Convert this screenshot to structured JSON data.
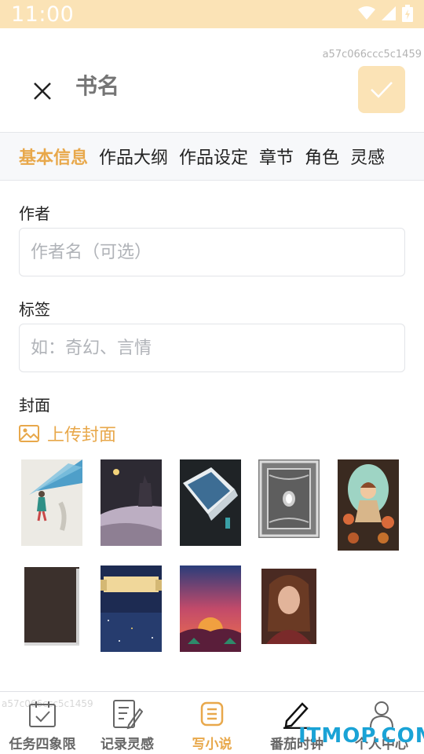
{
  "status_bar": {
    "time": "11:00",
    "icons": [
      "wifi-icon",
      "signal-icon",
      "battery-icon"
    ]
  },
  "watermark_id": "a57c066ccc5c1459",
  "header": {
    "title_placeholder": "书名",
    "close_icon": "close-icon",
    "confirm_icon": "check-icon"
  },
  "tabs": [
    {
      "label": "基本信息",
      "active": true
    },
    {
      "label": "作品大纲",
      "active": false
    },
    {
      "label": "作品设定",
      "active": false
    },
    {
      "label": "章节",
      "active": false
    },
    {
      "label": "角色",
      "active": false
    },
    {
      "label": "灵感",
      "active": false
    }
  ],
  "form": {
    "author": {
      "label": "作者",
      "placeholder": "作者名（可选）",
      "value": ""
    },
    "tags": {
      "label": "标签",
      "placeholder": "如：奇幻、言情",
      "value": ""
    },
    "cover": {
      "label": "封面",
      "upload_label": "上传封面"
    }
  },
  "covers": [
    "cover-girl-light",
    "cover-castle-night",
    "cover-open-book",
    "cover-silver-frame",
    "cover-girl-mushrooms",
    "cover-dark-book",
    "cover-starry-banner",
    "cover-sunset",
    "cover-portrait"
  ],
  "bottom_nav": {
    "watermark": "a57c066ccc5c1459",
    "items": [
      {
        "label": "任务四象限",
        "icon": "calendar-check-icon",
        "active": false
      },
      {
        "label": "记录灵感",
        "icon": "note-pen-icon",
        "active": false
      },
      {
        "label": "写小说",
        "icon": "document-list-icon",
        "active": true
      },
      {
        "label": "番茄时钟",
        "icon": "pen-icon",
        "active": false
      },
      {
        "label": "个人中心",
        "icon": "user-icon",
        "active": false
      }
    ]
  },
  "site_watermark": "ITMOP.COM",
  "colors": {
    "accent": "#e8a84b",
    "status_bar": "#fbe3b6",
    "confirm_bg": "#fbe3b6"
  }
}
